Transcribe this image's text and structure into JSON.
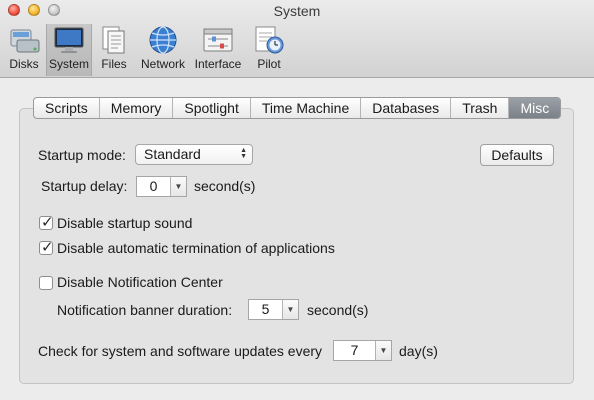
{
  "window": {
    "title": "System"
  },
  "toolbar": {
    "items": [
      {
        "label": "Disks",
        "icon": "disks-icon",
        "selected": false
      },
      {
        "label": "System",
        "icon": "system-icon",
        "selected": true
      },
      {
        "label": "Files",
        "icon": "files-icon",
        "selected": false
      },
      {
        "label": "Network",
        "icon": "network-icon",
        "selected": false
      },
      {
        "label": "Interface",
        "icon": "interface-icon",
        "selected": false
      },
      {
        "label": "Pilot",
        "icon": "pilot-icon",
        "selected": false
      }
    ]
  },
  "tabs": [
    "Scripts",
    "Memory",
    "Spotlight",
    "Time Machine",
    "Databases",
    "Trash",
    "Misc"
  ],
  "active_tab": "Misc",
  "misc": {
    "startup_mode_label": "Startup mode:",
    "startup_mode_value": "Standard",
    "defaults_label": "Defaults",
    "startup_delay_label": "Startup delay:",
    "startup_delay_value": "0",
    "startup_delay_unit": "second(s)",
    "disable_startup_sound": {
      "label": "Disable startup sound",
      "checked": true
    },
    "disable_auto_termination": {
      "label": "Disable automatic termination of applications",
      "checked": true
    },
    "disable_notification_center": {
      "label": "Disable Notification Center",
      "checked": false
    },
    "banner_duration_label": "Notification banner duration:",
    "banner_duration_value": "5",
    "banner_duration_unit": "second(s)",
    "updates_label": "Check for system and software updates every",
    "updates_value": "7",
    "updates_unit": "day(s)"
  },
  "colors": {
    "active_tab_bg": "#7b8188",
    "window_bg": "#ececec",
    "panel_bg": "#e3e3e3"
  }
}
